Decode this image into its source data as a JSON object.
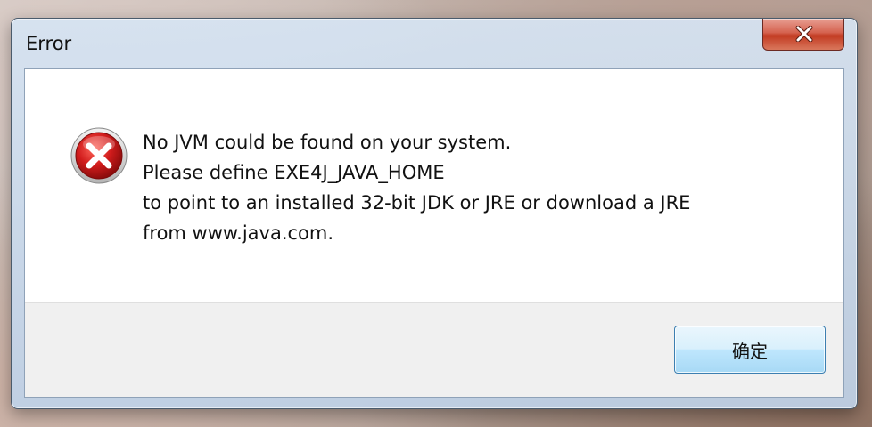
{
  "window": {
    "title": "Error"
  },
  "icons": {
    "close": "close-icon",
    "error": "error-icon"
  },
  "message": {
    "lines": [
      "No JVM could be found on your system.",
      "Please define EXE4J_JAVA_HOME",
      "to point to an installed 32-bit JDK or JRE or download a JRE",
      "from www.java.com."
    ]
  },
  "buttons": {
    "ok_label": "确定"
  },
  "colors": {
    "error_red": "#cc1c1c",
    "close_button_red": "#c23b22",
    "dialog_footer": "#f0f0f0"
  }
}
